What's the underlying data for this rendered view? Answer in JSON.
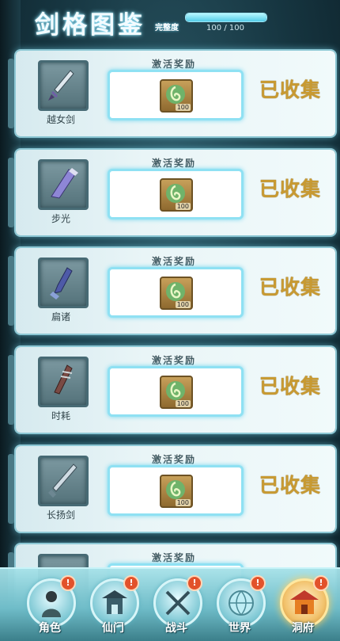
{
  "header": {
    "title": "剑格图鉴",
    "complete_label": "完整度",
    "progress_text": "100 / 100",
    "progress_fraction": 1.0
  },
  "cards": [
    {
      "name": "越女剑",
      "reward_title": "激活奖励",
      "reward_count": "100",
      "status": "已收集"
    },
    {
      "name": "步光",
      "reward_title": "激活奖励",
      "reward_count": "100",
      "status": "已收集"
    },
    {
      "name": "扁诸",
      "reward_title": "激活奖励",
      "reward_count": "100",
      "status": "已收集"
    },
    {
      "name": "时耗",
      "reward_title": "激活奖励",
      "reward_count": "100",
      "status": "已收集"
    },
    {
      "name": "长扬剑",
      "reward_title": "激活奖励",
      "reward_count": "100",
      "status": "已收集"
    },
    {
      "name": "",
      "reward_title": "激活奖励",
      "reward_count": "",
      "status": ""
    }
  ],
  "nav": [
    {
      "label": "角色",
      "badge": "!",
      "icon": "character-icon"
    },
    {
      "label": "仙门",
      "badge": "!",
      "icon": "sect-icon"
    },
    {
      "label": "战斗",
      "badge": "!",
      "icon": "battle-icon"
    },
    {
      "label": "世界",
      "badge": "!",
      "icon": "world-icon"
    },
    {
      "label": "洞府",
      "badge": "!",
      "icon": "cave-residence-icon"
    }
  ],
  "colors": {
    "accent": "#8fe1f3",
    "status_gold": "#c89a32",
    "badge_red": "#e2522b"
  }
}
